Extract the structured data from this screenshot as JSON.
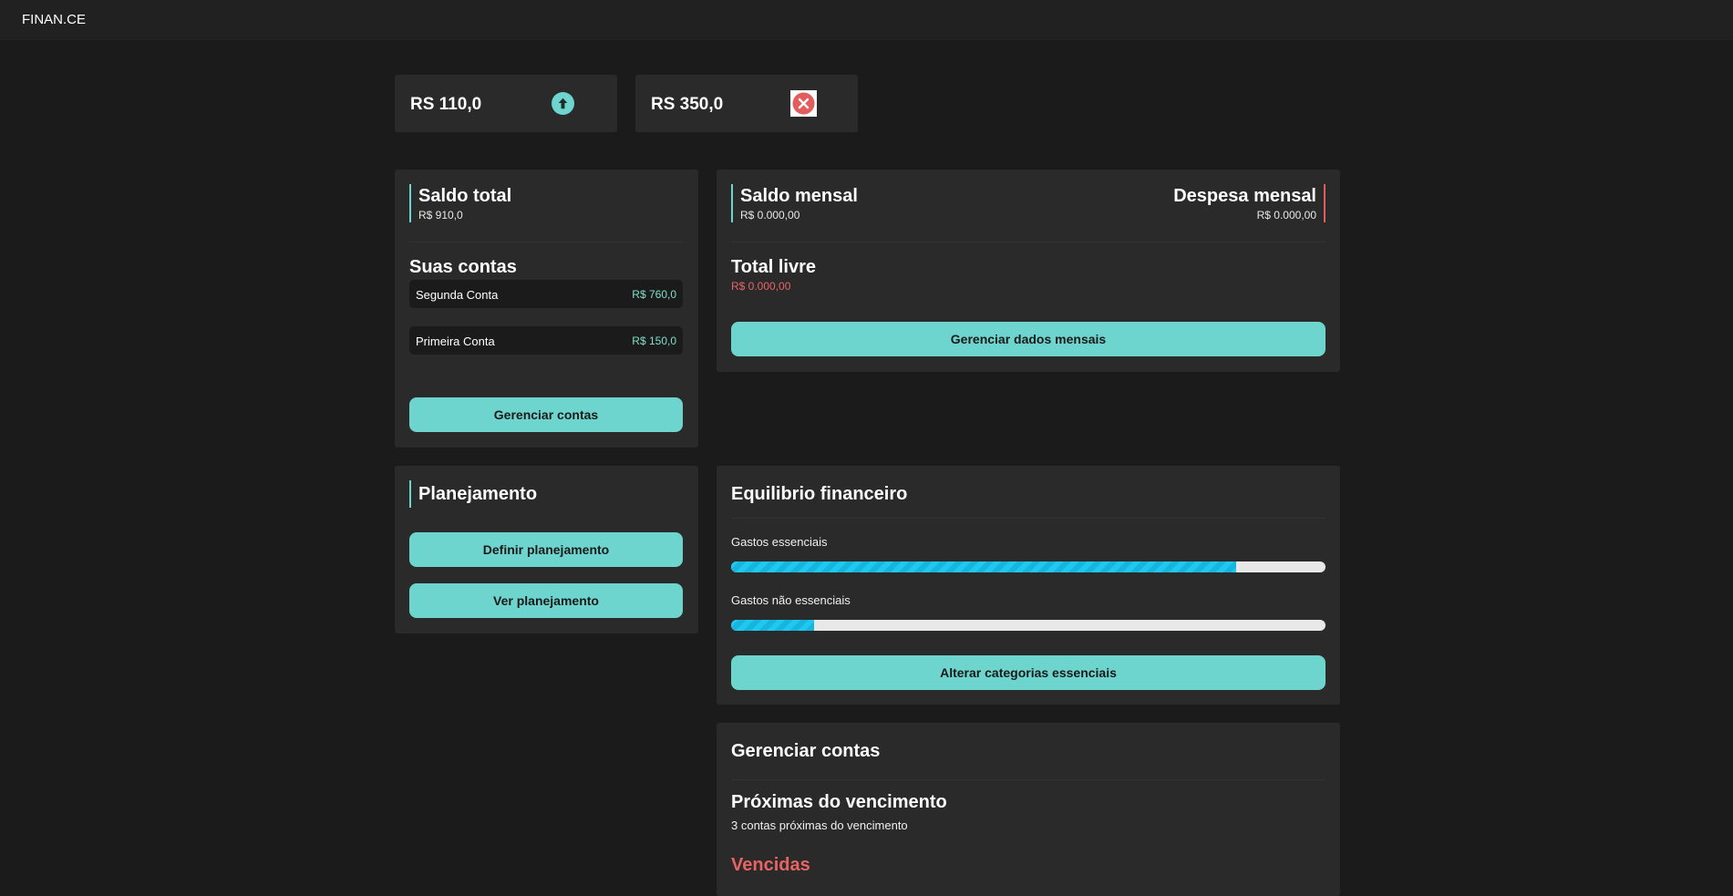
{
  "app": {
    "brand": "FINAN.CE"
  },
  "stats": {
    "income": {
      "amount": "RS 110,0",
      "icon": "arrow-up-circle-icon"
    },
    "expense": {
      "amount": "RS 350,0",
      "icon": "close-square-icon"
    }
  },
  "total_balance": {
    "title": "Saldo total",
    "value": "R$ 910,0",
    "accounts_title": "Suas contas",
    "accounts": [
      {
        "name": "Segunda Conta",
        "value": "R$ 760,0"
      },
      {
        "name": "Primeira Conta",
        "value": "R$ 150,0"
      }
    ],
    "manage_button": "Gerenciar contas"
  },
  "monthly": {
    "balance_title": "Saldo mensal",
    "balance_value": "R$ 0.000,00",
    "expense_title": "Despesa mensal",
    "expense_value": "R$ 0.000,00",
    "free_title": "Total livre",
    "free_value": "R$ 0.000,00",
    "manage_button": "Gerenciar dados mensais"
  },
  "planning": {
    "title": "Planejamento",
    "define_button": "Definir planejamento",
    "view_button": "Ver planejamento"
  },
  "balance": {
    "title": "Equilibrio financeiro",
    "bars": [
      {
        "label": "Gastos essenciais",
        "percent": 85
      },
      {
        "label": "Gastos não essenciais",
        "percent": 14
      }
    ],
    "change_button": "Alterar categorias essenciais"
  },
  "bills": {
    "title": "Gerenciar contas",
    "upcoming_title": "Próximas do vencimento",
    "upcoming_sub": "3 contas próximas do vencimento",
    "overdue_title": "Vencidas"
  },
  "colors": {
    "accent": "#6dd4ce",
    "danger": "#e86464",
    "progress": "#1ec8f0"
  }
}
